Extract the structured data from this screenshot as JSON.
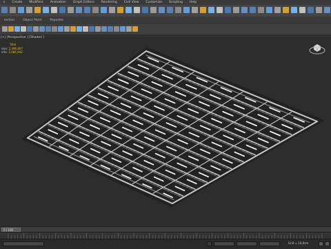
{
  "menu": [
    "s",
    "Create",
    "Modifiers",
    "Animation",
    "Graph Editors",
    "Rendering",
    "Civil View",
    "Customize",
    "Scripting",
    "Help"
  ],
  "tabs": [
    "lection",
    "Object Paint",
    "Populate"
  ],
  "viewport": {
    "label": "[+] [Perspective ] [Shaded ]",
    "stats_title": "Total",
    "polys_label": "olys:",
    "polys_value": "2,496,897",
    "verts_label": "erts:",
    "verts_value": "2,084,942"
  },
  "timeslider": {
    "frame": "0 / 100"
  },
  "status": {
    "grid": "Grid = 10,0cm"
  },
  "colors": {
    "accent": "#f0c040",
    "viewport_bg": "#2d2d2d",
    "model_line": "#c9c9c9"
  },
  "icons": [
    "undo-icon",
    "redo-icon",
    "link-icon",
    "unlink-icon",
    "bind-icon",
    "select-icon",
    "move-icon",
    "rotate-icon",
    "scale-icon",
    "snap-icon",
    "mirror-icon",
    "align-icon",
    "layer-icon",
    "curve-editor-icon",
    "render-setup-icon",
    "render-frame-icon",
    "render-icon",
    "viewcube-icon",
    "play-icon",
    "key-icon"
  ]
}
